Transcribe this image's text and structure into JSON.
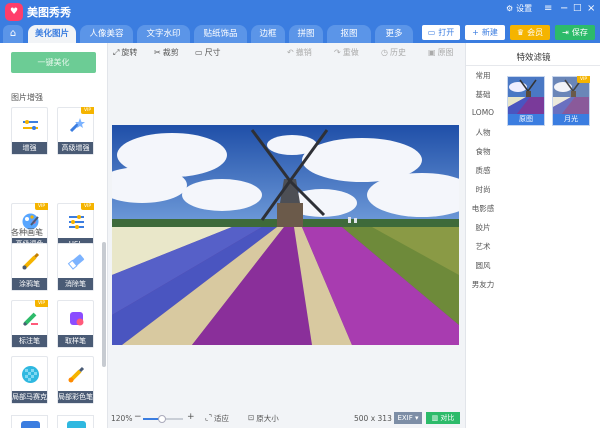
{
  "app": {
    "title": "美图秀秀",
    "settings_label": "设置"
  },
  "tabs": [
    {
      "label": "美化图片"
    },
    {
      "label": "人像美容"
    },
    {
      "label": "文字水印"
    },
    {
      "label": "贴纸饰品"
    },
    {
      "label": "边框"
    },
    {
      "label": "拼图"
    },
    {
      "label": "抠图"
    },
    {
      "label": "更多"
    }
  ],
  "actions": {
    "open": "打开",
    "new": "新建",
    "vip": "会员",
    "save": "保存"
  },
  "left": {
    "one_key": "一键美化",
    "section1": "图片增强",
    "tools1": [
      {
        "label": "增强",
        "vip": false
      },
      {
        "label": "高级增强",
        "vip": true
      },
      {
        "label": "高级调色",
        "vip": true
      },
      {
        "label": "HSL",
        "vip": true
      }
    ],
    "section2": "各种画笔",
    "tools2": [
      {
        "label": "涂鸦笔",
        "vip": false
      },
      {
        "label": "消除笔",
        "vip": false
      },
      {
        "label": "标注笔",
        "vip": true
      },
      {
        "label": "取样笔",
        "vip": false
      },
      {
        "label": "局部马赛克",
        "vip": false
      },
      {
        "label": "局部彩色笔",
        "vip": false
      }
    ],
    "vip_tag": "VIP"
  },
  "toolbar": {
    "rotate": "旋转",
    "crop": "裁剪",
    "size": "尺寸",
    "undo": "撤销",
    "redo": "重做",
    "history": "历史",
    "original": "原图"
  },
  "status": {
    "zoom": "120%",
    "minus": "−",
    "plus": "+",
    "fit": "适应",
    "actual": "原大小",
    "dimensions": "500 x 313",
    "exif": "EXIF",
    "compare": "对比"
  },
  "right": {
    "title": "特效滤镜",
    "categories": [
      "常用",
      "基础",
      "LOMO",
      "人物",
      "食物",
      "质感",
      "时尚",
      "电影感",
      "胶片",
      "艺术",
      "圆风",
      "男友力"
    ],
    "filters": [
      {
        "label": "原图",
        "vip": false
      },
      {
        "label": "月光",
        "vip": true
      }
    ]
  },
  "colors": {
    "accent": "#3b7de0",
    "vip": "#f5b400",
    "save": "#2dbb6a"
  }
}
